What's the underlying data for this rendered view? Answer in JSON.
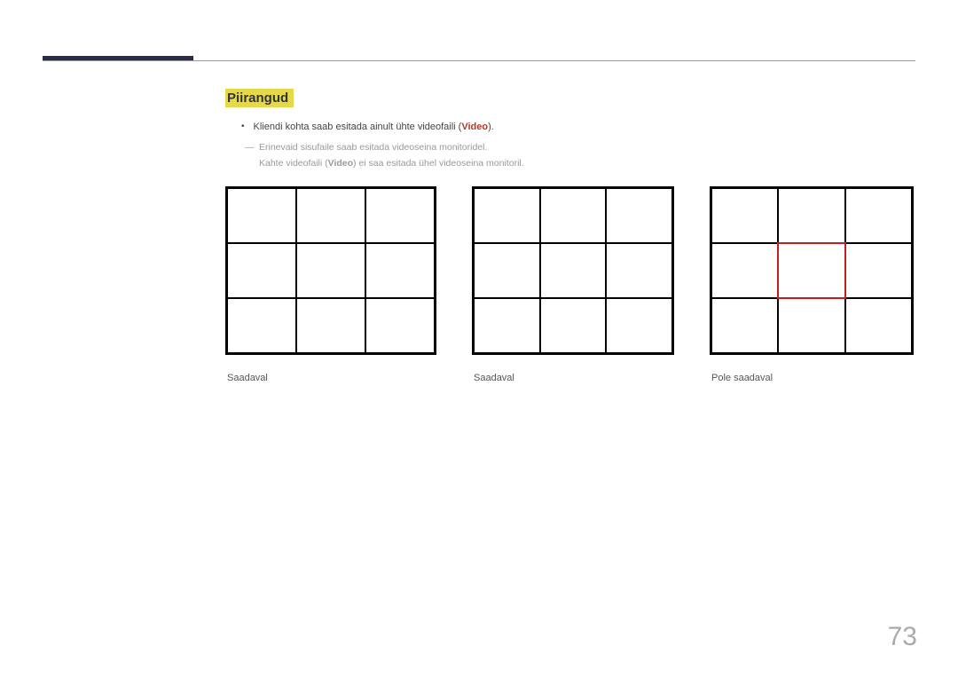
{
  "section_title": "Piirangud",
  "bullet": {
    "prefix": "Kliendi kohta saab esitada ainult ühte videofaili (",
    "video_label": "Video",
    "suffix": ")."
  },
  "sub1": "Erinevaid sisufaile saab esitada videoseina monitoridel.",
  "sub2": {
    "prefix": "Kahte videofaili (",
    "video_label": "Video",
    "suffix": ") ei saa esitada ühel videoseina monitoril."
  },
  "captions": {
    "g1": "Saadaval",
    "g2": "Saadaval",
    "g3": "Pole saadaval"
  },
  "page_number": "73"
}
